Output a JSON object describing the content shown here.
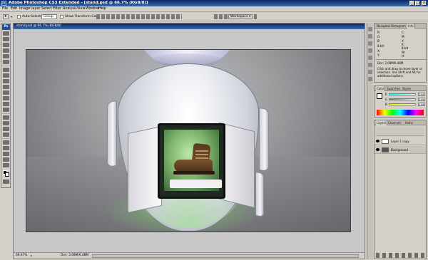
{
  "titlebar": {
    "title": "Adobe Photoshop CS3 Extended - [stand.psd @ 66.7% (RGB/8)]",
    "app_badge": "Ps"
  },
  "menu": [
    "File",
    "Edit",
    "Image",
    "Layer",
    "Select",
    "Filter",
    "Analysis",
    "View",
    "Window",
    "Help"
  ],
  "options": {
    "auto_select_label": "Auto-Select:",
    "auto_select_value": "Group",
    "transform_label": "Show Transform Controls",
    "workspace_label": "Workspace ▾"
  },
  "tools": {
    "badge": "Ps"
  },
  "document": {
    "title": "stand.psd @ 66.7% (RGB/8)",
    "zoom": "66.67%",
    "doc_size": "Doc: 3.08M/6.48M"
  },
  "navigator": {
    "tabs": [
      "Navigator",
      "Histogram",
      "Info"
    ],
    "info_lines": [
      "R:",
      "G:",
      "B:",
      "8-bit",
      "X:",
      "Y:",
      "C:",
      "M:",
      "Y:",
      "K:",
      "8-bit",
      "W:",
      "H:"
    ],
    "doc": "Doc: 3.08M/6.48M",
    "hint": "Click and drag to move layer or selection. Use Shift and Alt for additional options."
  },
  "color": {
    "tabs": [
      "Color",
      "Swatches",
      "Styles"
    ],
    "labels": [
      "R",
      "G",
      "B"
    ],
    "values": [
      "255",
      "255",
      "255"
    ]
  },
  "layers": {
    "tabs": [
      "Layers",
      "Channels",
      "Paths"
    ],
    "items": [
      {
        "name": "Layer 1 copy"
      },
      {
        "name": "Background"
      }
    ]
  },
  "colors": {
    "titlebar_start": "#0a246a",
    "titlebar_end": "#3a6ea5",
    "chrome": "#d4d0c8",
    "canvas_bg": "#c8c8c8"
  }
}
